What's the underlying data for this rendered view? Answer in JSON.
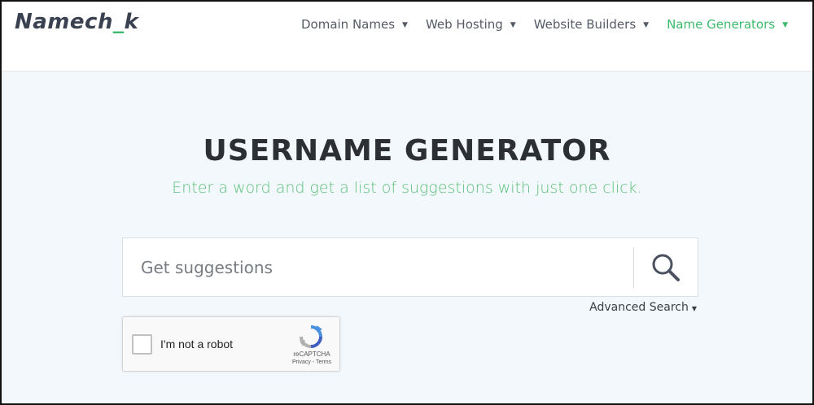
{
  "logo": {
    "part1": "Namech",
    "part2": "_",
    "part3": "k"
  },
  "nav": {
    "items": [
      {
        "label": "Domain Names",
        "caret": "▼"
      },
      {
        "label": "Web Hosting",
        "caret": "▼"
      },
      {
        "label": "Website Builders",
        "caret": "▼"
      },
      {
        "label": "Name Generators",
        "caret": "▼"
      }
    ]
  },
  "hero": {
    "title": "USERNAME GENERATOR",
    "subtitle": "Enter a word and get a list of suggestions with just one click."
  },
  "search": {
    "placeholder": "Get suggestions",
    "value": "",
    "button_icon": "search-icon",
    "advanced_label": "Advanced Search",
    "advanced_caret": "▼"
  },
  "captcha": {
    "label": "I'm not a robot",
    "brand": "reCAPTCHA",
    "links": "Privacy - Terms"
  },
  "colors": {
    "accent": "#3dbb6c",
    "text": "#2c2f33",
    "background": "#f3f8fc"
  }
}
